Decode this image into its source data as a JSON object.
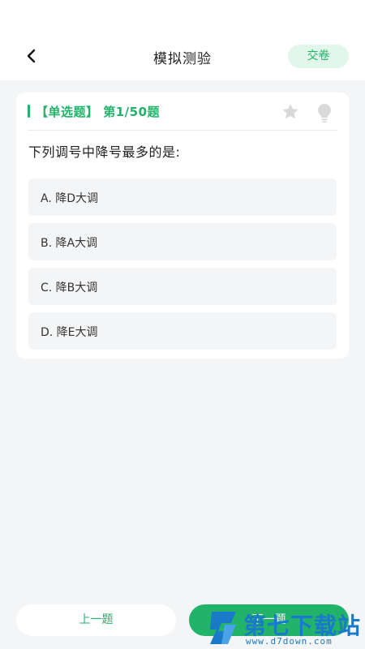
{
  "header": {
    "title": "模拟测验",
    "submit_label": "交卷"
  },
  "question": {
    "type_label": "【单选题】 第1/50题",
    "text": "下列调号中降号最多的是:",
    "options": [
      "A. 降D大调",
      "B. 降A大调",
      "C. 降B大调",
      "D. 降E大调"
    ]
  },
  "footer": {
    "prev_label": "上一题",
    "next_label": "下一题"
  },
  "watermark": {
    "text": "第七下载站",
    "url": "www.d7down.com"
  },
  "colors": {
    "accent": "#22b36a",
    "accent_light": "#e2f7ec",
    "background": "#f4f5f6",
    "watermark": "#1a79c9"
  },
  "icons": {
    "back": "chevron-left-icon",
    "favorite": "star-icon",
    "hint": "lightbulb-icon"
  }
}
